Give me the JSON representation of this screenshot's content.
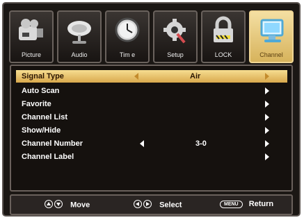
{
  "tabs": [
    {
      "label": "Picture",
      "icon": "camcorder-icon",
      "active": false
    },
    {
      "label": "Audio",
      "icon": "satellite-dish-icon",
      "active": false
    },
    {
      "label": "Tim e",
      "icon": "clock-icon",
      "active": false
    },
    {
      "label": "Setup",
      "icon": "gear-icon",
      "active": false
    },
    {
      "label": "LOCK",
      "icon": "lock-icon",
      "active": false
    },
    {
      "label": "Channel",
      "icon": "monitor-icon",
      "active": true
    }
  ],
  "rows": [
    {
      "label": "Signal Type",
      "value": "Air",
      "active": true
    },
    {
      "label": "Auto Scan",
      "value": "",
      "active": false
    },
    {
      "label": "Favorite",
      "value": "",
      "active": false
    },
    {
      "label": "Channel List",
      "value": "",
      "active": false
    },
    {
      "label": "Show/Hide",
      "value": "",
      "active": false
    },
    {
      "label": "Channel Number",
      "value": "3-0",
      "active": false
    },
    {
      "label": "Channel Label",
      "value": "",
      "active": false
    }
  ],
  "footer": {
    "move_label": "Move",
    "select_label": "Select",
    "menu_key": "MENU",
    "return_label": "Return"
  }
}
